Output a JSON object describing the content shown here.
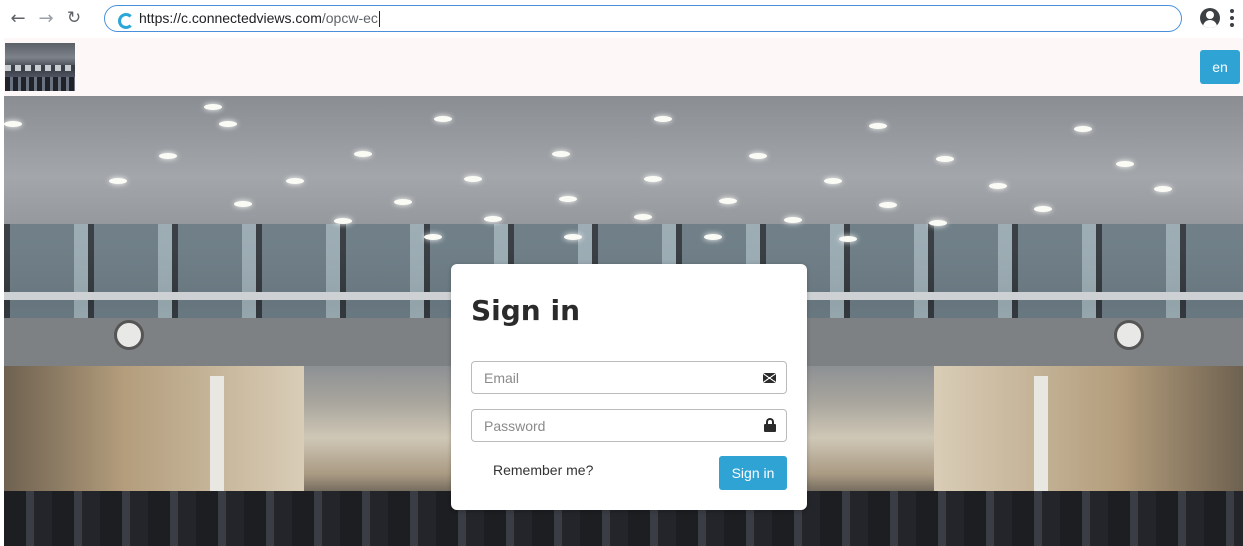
{
  "browser": {
    "url_host": "https://c.connectedviews.com",
    "url_path": "/opcw-ec"
  },
  "header": {
    "language": "en"
  },
  "login": {
    "title": "Sign in",
    "email_placeholder": "Email",
    "password_placeholder": "Password",
    "remember_label": "Remember me?",
    "submit_label": "Sign in"
  },
  "colors": {
    "accent": "#2ea3d4",
    "header_bg": "#fdf8f7",
    "card_bg": "#ffffff"
  },
  "icons": [
    "back-arrow-icon",
    "forward-arrow-icon",
    "reload-icon",
    "site-icon",
    "profile-icon",
    "menu-icon",
    "envelope-icon",
    "lock-icon"
  ]
}
